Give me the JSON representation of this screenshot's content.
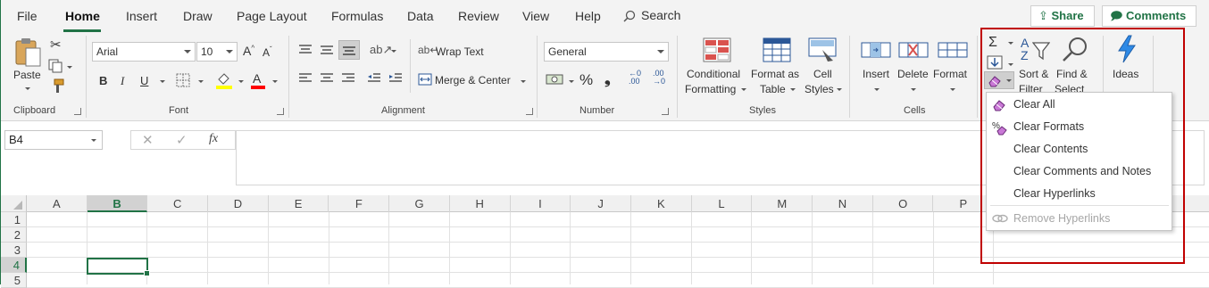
{
  "tabs": {
    "file": "File",
    "home": "Home",
    "insert": "Insert",
    "draw": "Draw",
    "page_layout": "Page Layout",
    "formulas": "Formulas",
    "data": "Data",
    "review": "Review",
    "view": "View",
    "help": "Help",
    "search": "Search",
    "share": "Share",
    "comments": "Comments"
  },
  "clipboard": {
    "paste": "Paste",
    "label": "Clipboard"
  },
  "font": {
    "name": "Arial",
    "size": "10",
    "bold": "B",
    "italic": "I",
    "underline": "U",
    "label": "Font",
    "grow": "A",
    "shrink": "A",
    "font_color_letter": "A"
  },
  "alignment": {
    "wrap_text": "Wrap Text",
    "merge_center": "Merge & Center",
    "label": "Alignment"
  },
  "number": {
    "format": "General",
    "percent": "%",
    "comma": "❟",
    "label": "Number"
  },
  "styles": {
    "conditional_line1": "Conditional",
    "conditional_line2": "Formatting",
    "format_as_line1": "Format as",
    "format_as_line2": "Table",
    "cell_styles_line1": "Cell",
    "cell_styles_line2": "Styles",
    "label": "Styles"
  },
  "cells": {
    "insert": "Insert",
    "delete": "Delete",
    "format": "Format",
    "label": "Cells"
  },
  "editing": {
    "sort_line1": "Sort &",
    "sort_line2": "Filter",
    "find_line1": "Find &",
    "find_line2": "Select"
  },
  "ideas": {
    "label": "Ideas"
  },
  "formula_bar": {
    "name_box": "B4",
    "fx": "fx"
  },
  "columns": [
    "A",
    "B",
    "C",
    "D",
    "E",
    "F",
    "G",
    "H",
    "I",
    "J",
    "K",
    "L",
    "M",
    "N",
    "O",
    "P"
  ],
  "rows": [
    "1",
    "2",
    "3",
    "4",
    "5"
  ],
  "selected": {
    "column": "B",
    "row": "4"
  },
  "clear_menu": {
    "items": [
      {
        "label": "Clear All",
        "icon": "eraser-icon",
        "enabled": true
      },
      {
        "label": "Clear Formats",
        "icon": "clear-formats-icon",
        "enabled": true
      },
      {
        "label": "Clear Contents",
        "icon": "",
        "enabled": true
      },
      {
        "label": "Clear Comments and Notes",
        "icon": "",
        "enabled": true
      },
      {
        "label": "Clear Hyperlinks",
        "icon": "",
        "enabled": true
      },
      {
        "label": "Remove Hyperlinks",
        "icon": "remove-hyperlinks-icon",
        "enabled": false
      }
    ]
  },
  "colors": {
    "accent": "#217346",
    "highlight_box": "#c00000",
    "font_color_bar": "#ff0000",
    "fill_color_bar": "#ffff00"
  }
}
